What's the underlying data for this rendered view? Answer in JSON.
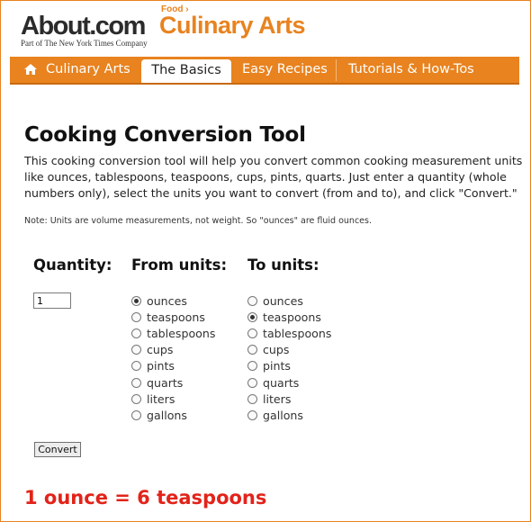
{
  "header": {
    "logo_text": "About.com",
    "tagline": "Part of The New York Times Company",
    "breadcrumb": "Food ›",
    "section_title": "Culinary Arts"
  },
  "nav": {
    "items": [
      {
        "label": "Culinary Arts",
        "icon": "home-icon"
      },
      {
        "label": "The Basics",
        "active": true
      },
      {
        "label": "Easy Recipes"
      },
      {
        "label": "Tutorials & How-Tos"
      }
    ]
  },
  "page": {
    "title": "Cooking Conversion Tool",
    "intro": "This cooking conversion tool will help you convert common cooking measurement units like ounces, tablespoons, teaspoons, cups, pints, quarts. Just enter a quantity (whole numbers only), select the units you want to convert (from and to), and click \"Convert.\"",
    "note": "Note: Units are volume measurements, not weight. So \"ounces\" are fluid ounces."
  },
  "form": {
    "quantity_label": "Quantity:",
    "from_label": "From units:",
    "to_label": "To units:",
    "quantity_value": "1",
    "units": [
      "ounces",
      "teaspoons",
      "tablespoons",
      "cups",
      "pints",
      "quarts",
      "liters",
      "gallons"
    ],
    "from_selected": "ounces",
    "to_selected": "teaspoons",
    "convert_label": "Convert"
  },
  "result": "1 ounce = 6 teaspoons",
  "colors": {
    "accent": "#e8831f",
    "result": "#e2231a"
  }
}
